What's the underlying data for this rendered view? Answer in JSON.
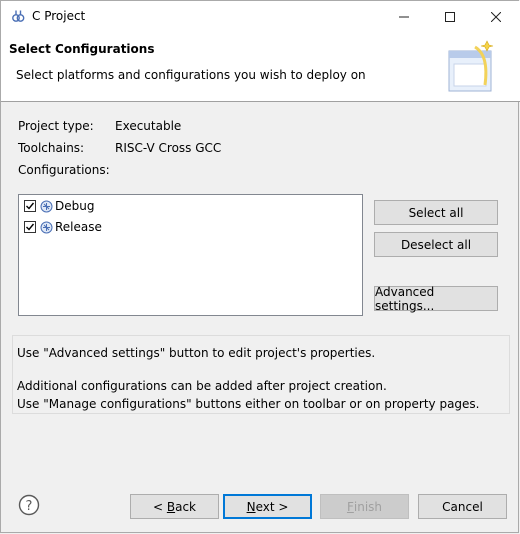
{
  "window": {
    "title": "C Project",
    "icons": {
      "app": "c-project-icon",
      "minimize": "minimize-icon",
      "maximize": "maximize-icon",
      "close": "close-icon"
    }
  },
  "header": {
    "title": "Select Configurations",
    "description": "Select platforms and configurations you wish to deploy on",
    "image": "wizard-banner-icon"
  },
  "project": {
    "type_label": "Project type:",
    "type_value": "Executable",
    "toolchains_label": "Toolchains:",
    "toolchains_value": "RISC-V Cross GCC",
    "configurations_label": "Configurations:"
  },
  "configurations": [
    {
      "label": "Debug",
      "checked": true,
      "icon": "configuration-icon"
    },
    {
      "label": "Release",
      "checked": true,
      "icon": "configuration-icon"
    }
  ],
  "side_buttons": {
    "select_all": "Select all",
    "deselect_all": "Deselect all",
    "advanced": "Advanced settings..."
  },
  "info": {
    "line1": "Use \"Advanced settings\" button to edit project's properties.",
    "line2": "Additional configurations can be added after project creation.",
    "line3": "Use \"Manage configurations\" buttons either on toolbar or on property pages."
  },
  "footer": {
    "help_icon": "help-icon",
    "back": {
      "prefix": "< ",
      "mnemonic": "B",
      "rest": "ack"
    },
    "next": {
      "mnemonic": "N",
      "rest": "ext >"
    },
    "finish": {
      "mnemonic": "F",
      "rest": "inish",
      "disabled": true
    },
    "cancel": "Cancel",
    "colors": {
      "default_border": "#0078d7",
      "disabled_text": "#a0a0a0"
    }
  }
}
